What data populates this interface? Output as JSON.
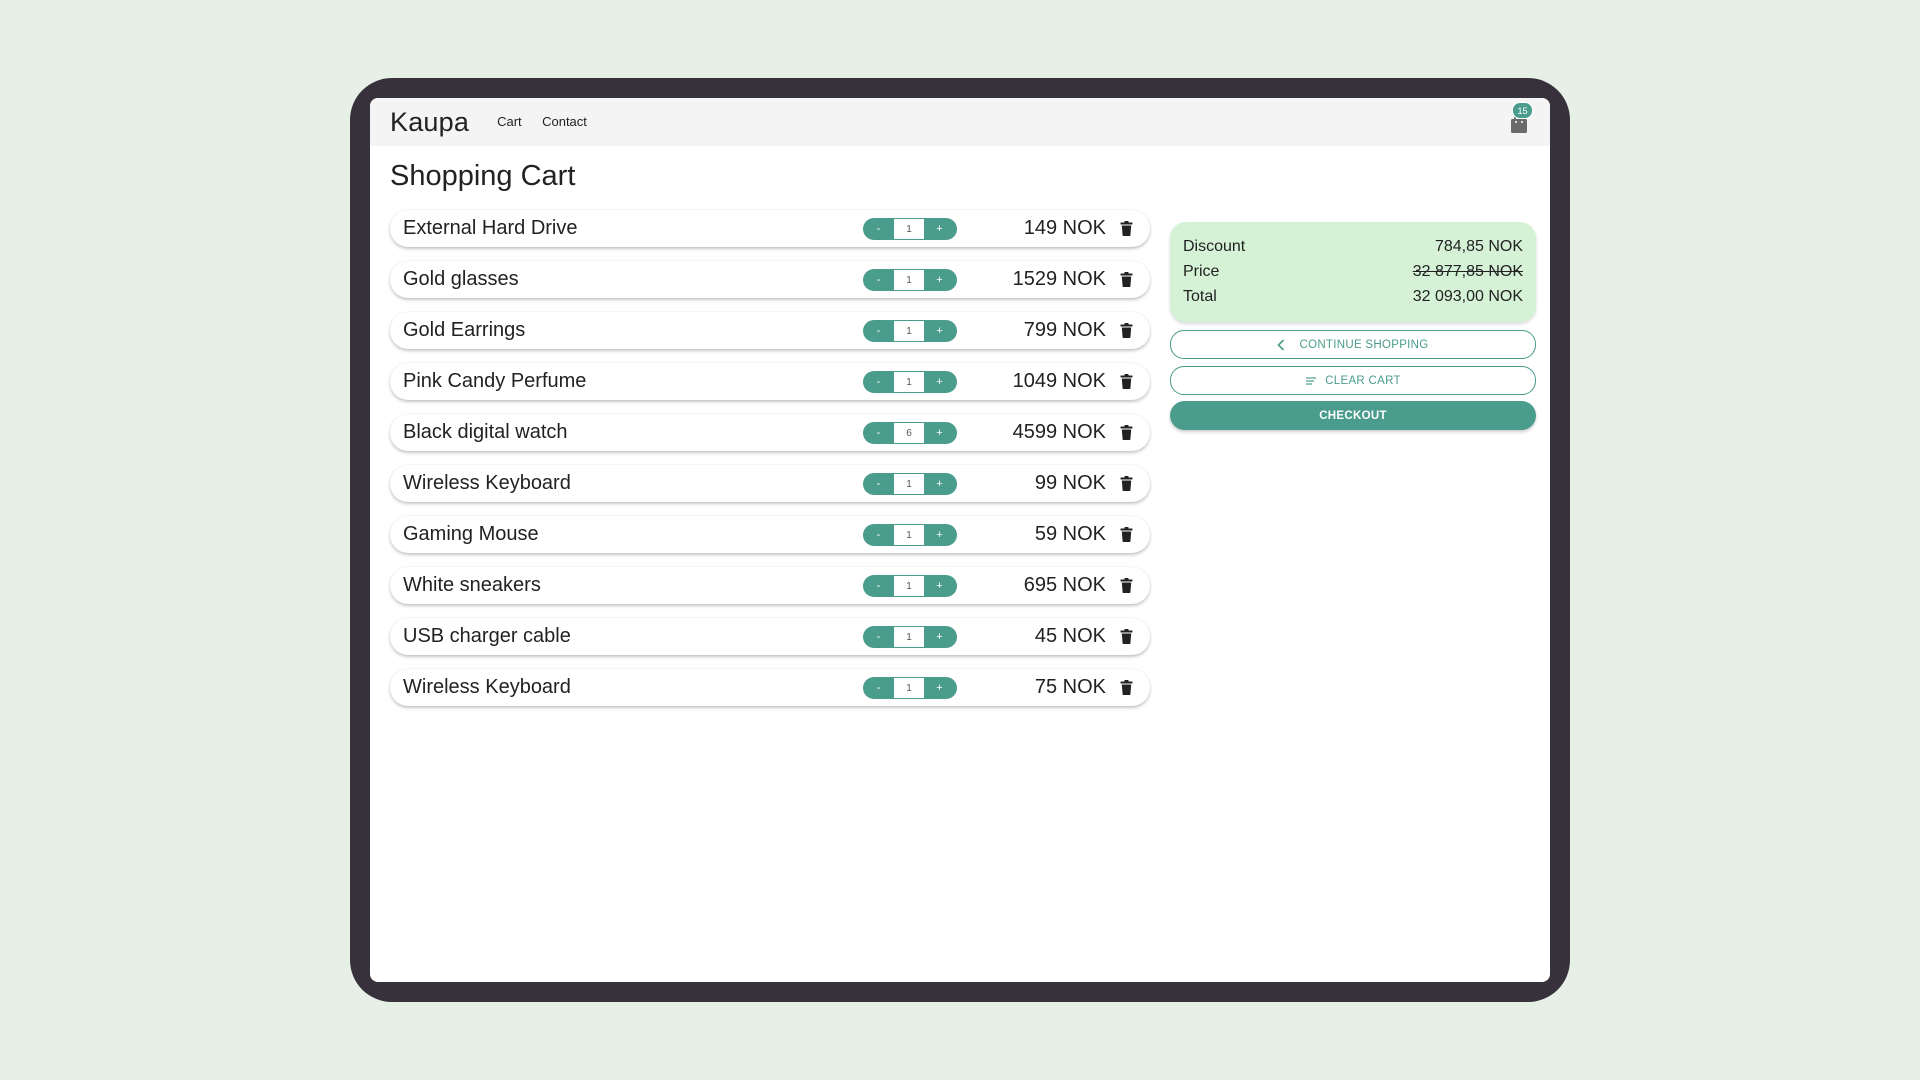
{
  "header": {
    "brand": "Kaupa",
    "nav": [
      "Cart",
      "Contact"
    ],
    "cart_icon": "shopping-bag-icon",
    "cart_count": "15"
  },
  "page": {
    "title": "Shopping Cart"
  },
  "cart": {
    "items": [
      {
        "name": "External Hard Drive",
        "qty": "1",
        "price": "149 NOK"
      },
      {
        "name": "Gold glasses",
        "qty": "1",
        "price": "1529 NOK"
      },
      {
        "name": "Gold Earrings",
        "qty": "1",
        "price": "799 NOK"
      },
      {
        "name": "Pink Candy Perfume",
        "qty": "1",
        "price": "1049 NOK"
      },
      {
        "name": "Black digital watch",
        "qty": "6",
        "price": "4599 NOK"
      },
      {
        "name": "Wireless Keyboard",
        "qty": "1",
        "price": "99 NOK"
      },
      {
        "name": "Gaming Mouse",
        "qty": "1",
        "price": "59 NOK"
      },
      {
        "name": "White sneakers",
        "qty": "1",
        "price": "695 NOK"
      },
      {
        "name": "USB charger cable",
        "qty": "1",
        "price": "45 NOK"
      },
      {
        "name": "Wireless Keyboard",
        "qty": "1",
        "price": "75 NOK"
      }
    ],
    "decrement_label": "-",
    "increment_label": "+",
    "delete_icon": "trash-icon"
  },
  "summary": {
    "discount_label": "Discount",
    "discount_value": "784,85 NOK",
    "price_label": "Price",
    "price_value": "32 877,85 NOK",
    "total_label": "Total",
    "total_value": "32 093,00 NOK"
  },
  "actions": {
    "continue_label": "CONTINUE SHOPPING",
    "continue_icon": "chevron-left-icon",
    "clear_label": "CLEAR CART",
    "clear_icon": "clear-list-icon",
    "checkout_label": "CHECKOUT"
  },
  "colors": {
    "background": "#e6f0e6",
    "accent": "#4a9c8c",
    "summary_bg": "#d5f2d7",
    "device_frame": "#36313a"
  }
}
